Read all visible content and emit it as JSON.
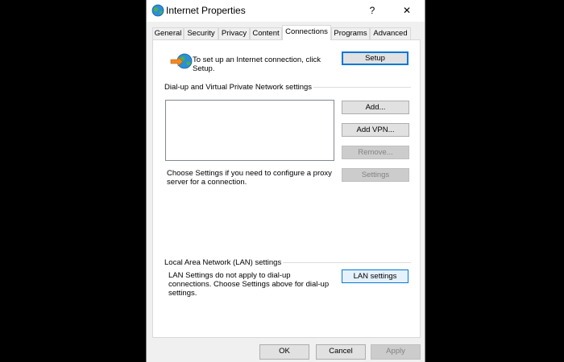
{
  "window": {
    "title": "Internet Properties",
    "help_label": "?",
    "close_label": "✕"
  },
  "tabs": [
    {
      "label": "General"
    },
    {
      "label": "Security"
    },
    {
      "label": "Privacy"
    },
    {
      "label": "Content"
    },
    {
      "label": "Connections",
      "active": true
    },
    {
      "label": "Programs"
    },
    {
      "label": "Advanced"
    }
  ],
  "setup": {
    "text": "To set up an Internet connection, click Setup.",
    "button_label": "Setup"
  },
  "vpn": {
    "group_label": "Dial-up and Virtual Private Network settings",
    "add_label": "Add...",
    "add_vpn_label": "Add VPN...",
    "remove_label": "Remove...",
    "settings_label": "Settings",
    "proxy_text": "Choose Settings if you need to configure a proxy server for a connection."
  },
  "lan": {
    "group_label": "Local Area Network (LAN) settings",
    "text": "LAN Settings do not apply to dial-up connections. Choose Settings above for dial-up settings.",
    "button_label": "LAN settings"
  },
  "footer": {
    "ok_label": "OK",
    "cancel_label": "Cancel",
    "apply_label": "Apply"
  },
  "colors": {
    "focus_border": "#0078d7",
    "disabled_text": "#838383"
  },
  "icons": {
    "title": "globe-internet-icon",
    "setup": "globe-arrow-connection-icon"
  }
}
